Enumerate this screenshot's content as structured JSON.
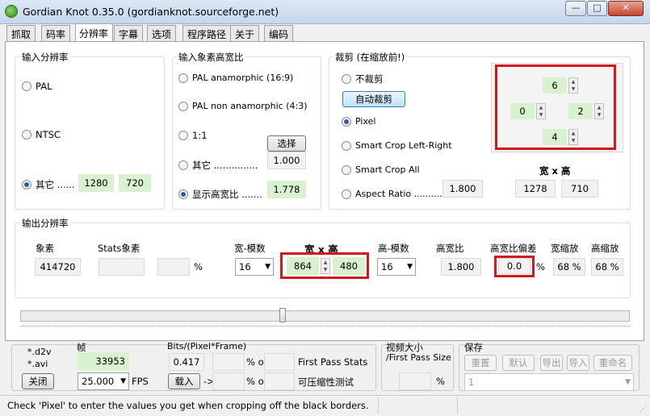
{
  "window": {
    "title": "Gordian Knot 0.35.0  (gordianknot.sourceforge.net)",
    "min": "—",
    "max": "□",
    "close": "✕"
  },
  "tabs": [
    "抓取",
    "码率",
    "分辨率",
    "字幕",
    "选项",
    "程序路径",
    "关于",
    "编码"
  ],
  "input_res": {
    "title": "输入分辨率",
    "pal": "PAL",
    "ntsc": "NTSC",
    "other": "其它 ......",
    "w": "1280",
    "h": "720"
  },
  "input_ar": {
    "title": "输入象素高宽比",
    "pal_ana": "PAL anamorphic (16:9)",
    "pal_non": "PAL non anamorphic (4:3)",
    "r11": "1:1",
    "other": "其它 ...............",
    "select_btn": "选择",
    "val": "1.000",
    "show": "显示高宽比 .......",
    "show_val": "1.778"
  },
  "crop": {
    "title": "裁剪 (在缩放前!)",
    "none": "不裁剪",
    "auto_btn": "自动裁剪",
    "pixel": "Pixel",
    "smart_lr": "Smart Crop Left-Right",
    "smart_all": "Smart Crop All",
    "ar": "Aspect Ratio  ...........",
    "ar_val": "1.800",
    "wh_label": "宽 x 高",
    "w": "1278",
    "h": "710",
    "top": "6",
    "left": "0",
    "right": "2",
    "bottom": "4"
  },
  "output": {
    "title": "输出分辨率",
    "pixels_label": "象素",
    "pixels": "414720",
    "stats_label": "Stats象素",
    "pct": "%",
    "wmod_label": "宽-模数",
    "wmod": "16",
    "wh_label": "宽 x 高",
    "w": "864",
    "h": "480",
    "hmod_label": "高-模数",
    "hmod": "16",
    "ar_label": "高宽比",
    "ar": "1.800",
    "arerr_label": "高宽比偏差",
    "arerr": "0.0",
    "arerr_pct": "%",
    "wscale_label": "宽缩放",
    "wscale": "68 %",
    "hscale_label": "高缩放",
    "hscale": "68 %"
  },
  "bottom": {
    "ext1": "*.d2v",
    "ext2": "*.avi",
    "close_btn": "关闭",
    "frames_label": "帧",
    "frames": "33953",
    "fps": "25.000",
    "fps_label": "FPS",
    "bpp_label": "Bits/(Pixel*Frame)",
    "bpp": "0.417",
    "pct_of1": "% of",
    "first_pass": "First Pass Stats",
    "load_btn": "载入",
    "arrow": "->",
    "pct_of2": "% of",
    "compress": "可压缩性测试",
    "vsize_label": "视频大小",
    "vsize_sub": "/First Pass Size",
    "vpct": "%",
    "save_label": "保存",
    "reset": "重置",
    "default": "默认",
    "export": "导出",
    "import": "导入",
    "rename": "重命名",
    "save_sel": "1"
  },
  "status": "Check 'Pixel' to enter the values you get when cropping off the black borders.",
  "slider": {
    "position_fraction": 0.43
  }
}
